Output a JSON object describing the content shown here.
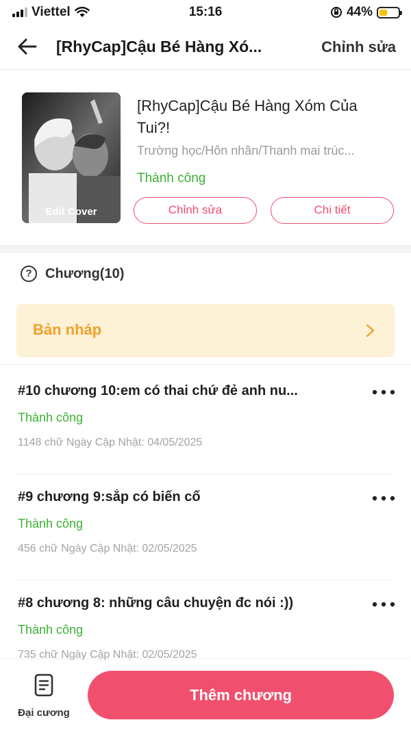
{
  "status_bar": {
    "carrier": "Viettel",
    "time": "15:16",
    "battery": "44%",
    "battery_level": 0.44,
    "battery_color": "#f5c400"
  },
  "nav": {
    "back_icon": "arrow-left-icon",
    "title": "[RhyCap]Cậu Bé Hàng Xó...",
    "edit_label": "Chỉnh sửa"
  },
  "book": {
    "cover_label": "Edit Cover",
    "title": "[RhyCap]Cậu Bé Hàng Xóm Của Tui?!",
    "genres": "Trường học/Hôn nhân/Thanh mai trúc...",
    "status": "Thành công",
    "edit_button": "Chỉnh sửa",
    "detail_button": "Chi tiết"
  },
  "chapters": {
    "help_icon": "question-circle-icon",
    "count_label": "Chương(10)",
    "draft_label": "Bản nháp",
    "items": [
      {
        "title": "#10 chương 10:em có thai chứ đẻ anh nu...",
        "status": "Thành công",
        "meta": "1148 chữ Ngày Cập Nhật: 04/05/2025"
      },
      {
        "title": "#9 chương 9:sắp có biến cố",
        "status": "Thành công",
        "meta": "456 chữ Ngày Cập Nhật: 02/05/2025"
      },
      {
        "title": "#8 chương 8: những câu chuyện đc nói :))",
        "status": "Thành công",
        "meta": "735 chữ Ngày Cập Nhật: 02/05/2025"
      }
    ]
  },
  "bottom": {
    "outline_label": "Đại cương",
    "add_chapter_label": "Thêm chương"
  },
  "colors": {
    "accent": "#f0506e",
    "success": "#3cb034",
    "draft_bg": "#fdf1d6",
    "draft_text": "#f0a12a"
  }
}
